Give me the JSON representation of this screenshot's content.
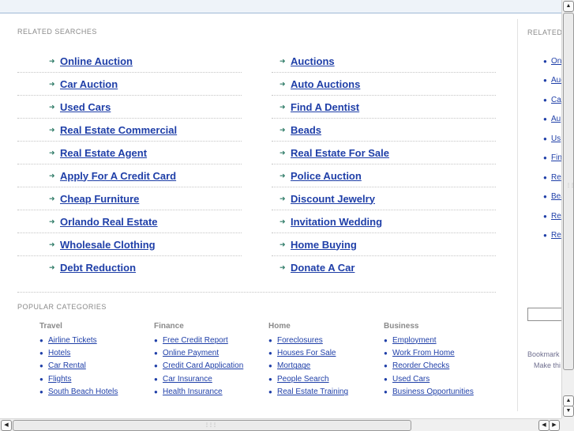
{
  "related_searches": {
    "title": "RELATED SEARCHES",
    "left": [
      "Online Auction",
      "Car Auction",
      "Used Cars",
      "Real Estate Commercial",
      "Real Estate Agent",
      "Apply For A Credit Card",
      "Cheap Furniture",
      "Orlando Real Estate",
      "Wholesale Clothing",
      "Debt Reduction"
    ],
    "right": [
      "Auctions",
      "Auto Auctions",
      "Find A Dentist",
      "Beads",
      "Real Estate For Sale",
      "Police Auction",
      "Discount Jewelry",
      "Invitation Wedding",
      "Home Buying",
      "Donate A Car"
    ]
  },
  "popular_categories": {
    "title": "POPULAR CATEGORIES",
    "columns": [
      {
        "heading": "Travel",
        "links": [
          "Airline Tickets",
          "Hotels",
          "Car Rental",
          "Flights",
          "South Beach Hotels"
        ]
      },
      {
        "heading": "Finance",
        "links": [
          "Free Credit Report",
          "Online Payment",
          "Credit Card Application",
          "Car Insurance",
          "Health Insurance"
        ]
      },
      {
        "heading": "Home",
        "links": [
          "Foreclosures",
          "Houses For Sale",
          "Mortgage",
          "People Search",
          "Real Estate Training"
        ]
      },
      {
        "heading": "Business",
        "links": [
          "Employment",
          "Work From Home",
          "Reorder Checks",
          "Used Cars",
          "Business Opportunities"
        ]
      }
    ]
  },
  "sidebar": {
    "title": "RELATED",
    "items": [
      "Onl",
      "Auc",
      "Ca",
      "Au",
      "Us",
      "Fin",
      "Re",
      "Bea",
      "Re",
      "Re"
    ],
    "footer_line1": "Bookmark",
    "footer_line2": "Make thi"
  },
  "icons": {
    "arrow": "right-arrow-icon",
    "bullet": "bullet-icon",
    "scroll_up": "up-triangle-icon",
    "scroll_down": "down-triangle-icon",
    "scroll_left": "left-triangle-icon",
    "scroll_right": "right-triangle-icon"
  },
  "colors": {
    "link": "#1f3fa8",
    "arrow": "#2e7b67",
    "header_line": "#9fb9d6"
  }
}
